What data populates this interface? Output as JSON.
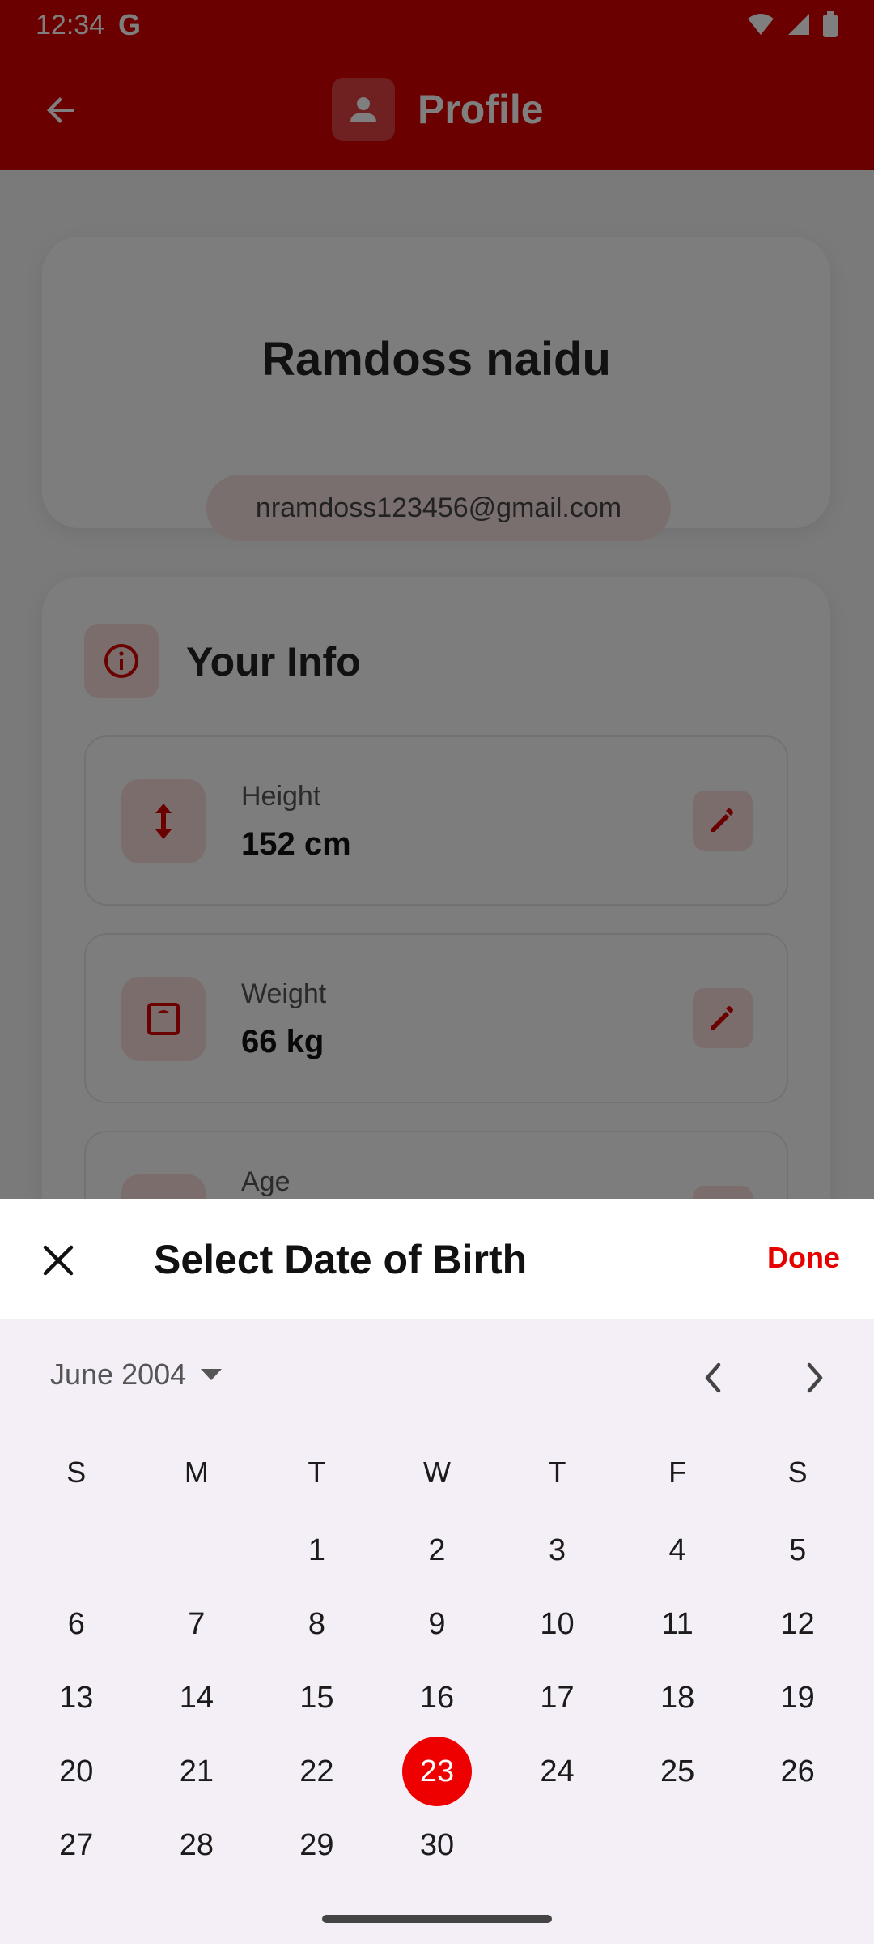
{
  "status": {
    "time": "12:34",
    "g": "G"
  },
  "appbar": {
    "title": "Profile"
  },
  "profile": {
    "name": "Ramdoss naidu",
    "email": "nramdoss123456@gmail.com"
  },
  "info": {
    "title": "Your Info",
    "rows": [
      {
        "label": "Height",
        "value": "152 cm"
      },
      {
        "label": "Weight",
        "value": "66 kg"
      },
      {
        "label": "Age",
        "value": ""
      }
    ]
  },
  "sheet": {
    "title": "Select Date of Birth",
    "done": "Done",
    "month": "June 2004",
    "weekdays": [
      "S",
      "M",
      "T",
      "W",
      "T",
      "F",
      "S"
    ],
    "weeks": [
      [
        "",
        "",
        "1",
        "2",
        "3",
        "4",
        "5"
      ],
      [
        "6",
        "7",
        "8",
        "9",
        "10",
        "11",
        "12"
      ],
      [
        "13",
        "14",
        "15",
        "16",
        "17",
        "18",
        "19"
      ],
      [
        "20",
        "21",
        "22",
        "23",
        "24",
        "25",
        "26"
      ],
      [
        "27",
        "28",
        "29",
        "30",
        "",
        "",
        ""
      ]
    ],
    "selected_day": "23"
  },
  "colors": {
    "accent": "#e60000",
    "appbar": "#d40000",
    "sheet_bg": "#f4eff6"
  }
}
